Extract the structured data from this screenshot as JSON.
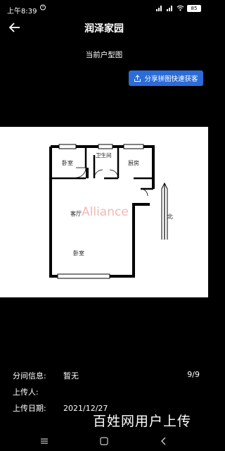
{
  "status_bar": {
    "time": "上午8:39",
    "battery": "85"
  },
  "app_bar": {
    "title": "润泽家园"
  },
  "content": {
    "subtitle": "当前户型图",
    "share_button_label": "分享拼图快速获客"
  },
  "floor_plan": {
    "rooms": {
      "bedroom_top": "卧室",
      "bathroom": "卫生间",
      "kitchen": "厨房",
      "living_room": "客厅",
      "bedroom_bottom": "卧室"
    },
    "north_label": "北",
    "logo_text": "Alliance"
  },
  "info": {
    "partition_label": "分间信息:",
    "partition_value": "暂无",
    "page_counter": "9/9",
    "uploader_label": "上传人:",
    "uploader_value": "",
    "upload_date_label": "上传日期:",
    "upload_date_value": "2021/12/27"
  },
  "watermark_bottom": "百姓网用户上传"
}
